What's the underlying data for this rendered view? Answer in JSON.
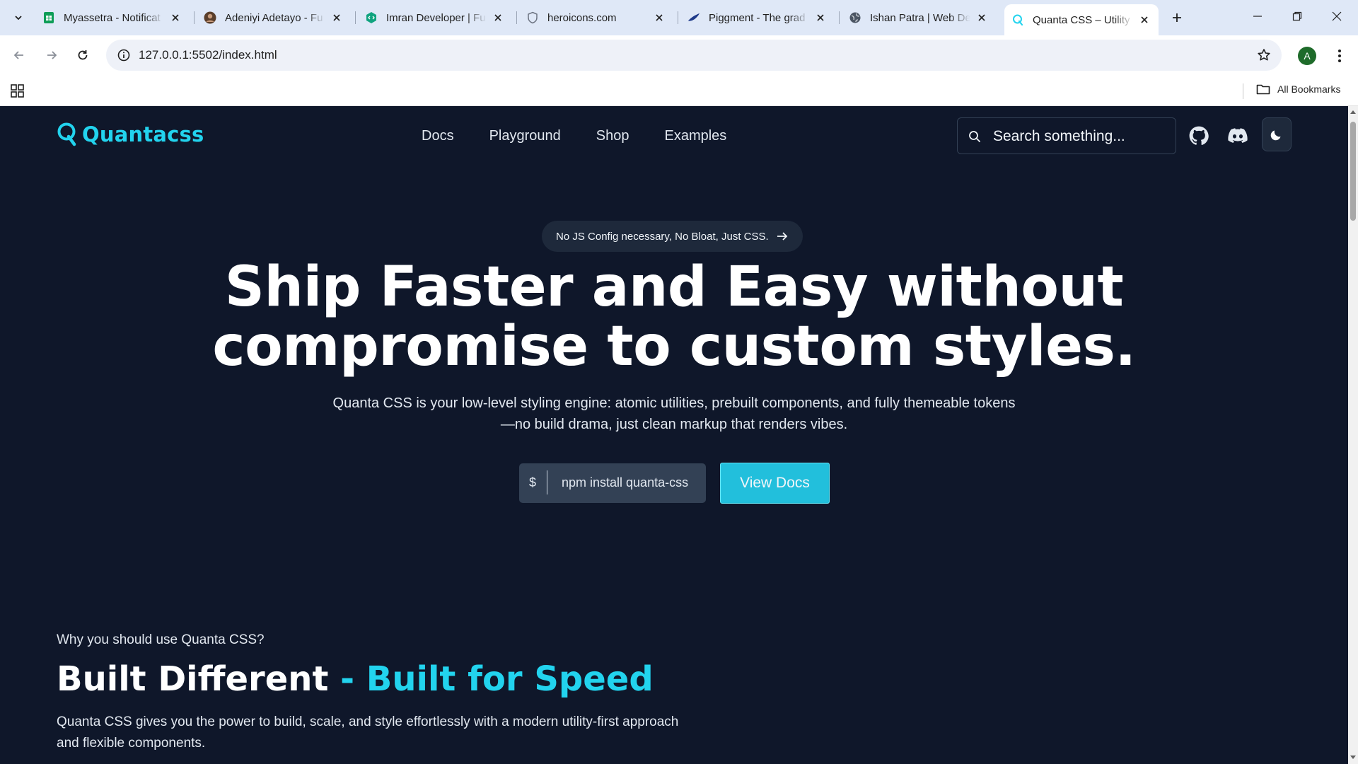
{
  "browser": {
    "tabs": [
      {
        "title": "Myassetra - Notificat",
        "icon": "sheets-icon"
      },
      {
        "title": "Adeniyi Adetayo - Fu",
        "icon": "avatar-icon"
      },
      {
        "title": "Imran Developer | Fu",
        "icon": "code-icon"
      },
      {
        "title": "heroicons.com",
        "icon": "shield-icon"
      },
      {
        "title": "Piggment - The grad",
        "icon": "feather-icon"
      },
      {
        "title": "Ishan Patra | Web De",
        "icon": "globe-icon"
      },
      {
        "title": "Quanta CSS – Utility",
        "icon": "quanta-icon",
        "active": true
      }
    ],
    "url": "127.0.0.1:5502/index.html",
    "profile_initial": "A",
    "all_bookmarks": "All Bookmarks"
  },
  "site": {
    "logo": "Quantacss",
    "nav": [
      "Docs",
      "Playground",
      "Shop",
      "Examples"
    ],
    "search_placeholder": "Search something...",
    "announcement": "No JS Config necessary, No Bloat, Just CSS.",
    "hero": {
      "title_line1": "Ship Faster and Easy without",
      "title_line2": "compromise to custom styles.",
      "subtitle_line1": "Quanta CSS is your low-level styling engine: atomic utilities, prebuilt components, and fully themeable tokens",
      "subtitle_line2": "—no build drama, just clean markup that renders vibes.",
      "cmd_prompt": "$",
      "cmd_text": "npm install quanta-css",
      "cta": "View Docs"
    },
    "features": {
      "eyebrow": "Why you should use Quanta CSS?",
      "title_main": "Built Different",
      "title_accent": " - Built for Speed",
      "description": "Quanta CSS gives you the power to build, scale, and style effortlessly with a modern utility-first approach and flexible components."
    }
  },
  "colors": {
    "accent": "#22d3ee",
    "page_bg": "#0f172a",
    "button": "#22bfdc",
    "surface": "#1e293b"
  }
}
